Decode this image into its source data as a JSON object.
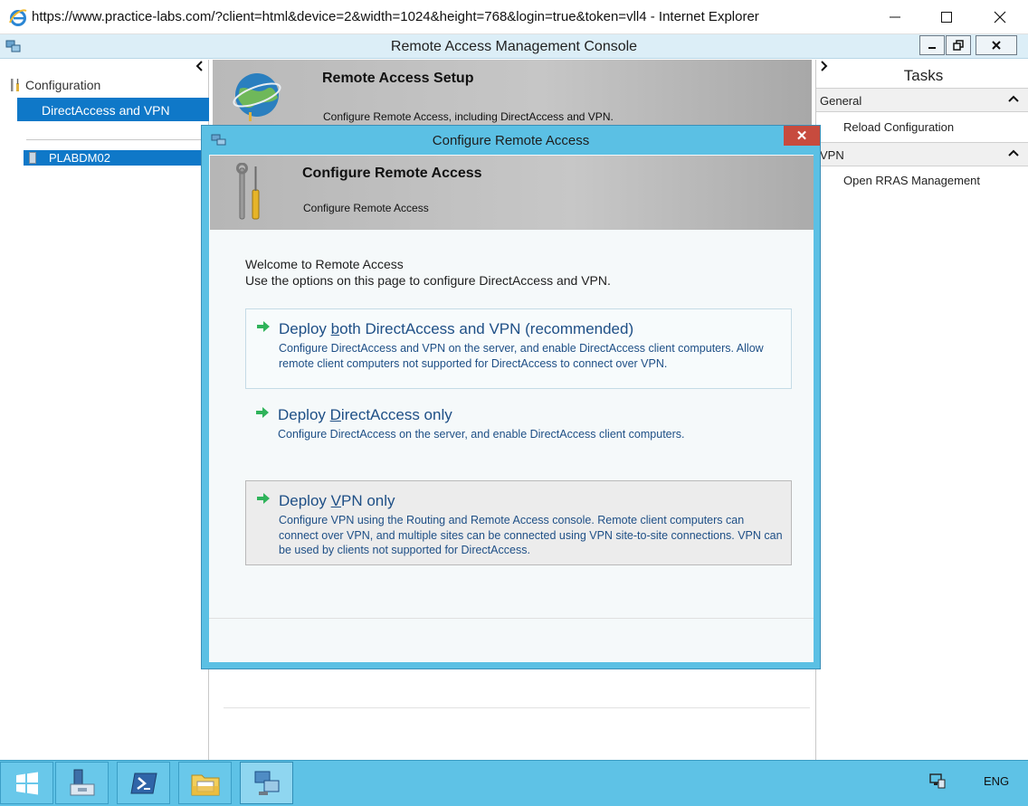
{
  "browser": {
    "title": "https://www.practice-labs.com/?client=html&device=2&width=1024&height=768&login=true&token=vll4 - Internet Explorer",
    "app_icon": "internet-explorer-icon"
  },
  "console": {
    "title": "Remote Access Management Console"
  },
  "left_nav": {
    "root_label": "Configuration",
    "selected_item": "DirectAccess and VPN",
    "server_name": "PLABDM02"
  },
  "center": {
    "banner_title": "Remote Access Setup",
    "banner_desc": "Configure Remote Access, including DirectAccess and VPN."
  },
  "tasks": {
    "title": "Tasks",
    "groups": [
      {
        "header": "General",
        "items": [
          "Reload Configuration"
        ]
      },
      {
        "header": "VPN",
        "items": [
          "Open RRAS Management"
        ]
      }
    ]
  },
  "dialog": {
    "title": "Configure Remote Access",
    "close_label": "✕",
    "banner_title": "Configure Remote Access",
    "banner_desc": "Configure Remote Access",
    "welcome_line1": "Welcome to Remote Access",
    "welcome_line2": "Use the options on this page to configure DirectAccess and VPN.",
    "options": [
      {
        "title_pre": "Deploy ",
        "title_key": "b",
        "title_post": "oth DirectAccess and VPN (recommended)",
        "desc": "Configure DirectAccess and VPN on the server, and enable DirectAccess client computers. Allow remote client computers not supported for DirectAccess to connect over VPN."
      },
      {
        "title_pre": "Deploy ",
        "title_key": "D",
        "title_post": "irectAccess only",
        "desc": "Configure DirectAccess on the server, and enable DirectAccess client computers."
      },
      {
        "title_pre": "Deploy ",
        "title_key": "V",
        "title_post": "PN only",
        "desc": "Configure VPN using the Routing and Remote Access console. Remote client computers can connect over VPN, and multiple sites can be connected using VPN site-to-site connections. VPN can be used by clients not supported for DirectAccess."
      }
    ]
  },
  "taskbar": {
    "buttons": [
      "start-icon",
      "server-manager-icon",
      "powershell-icon",
      "file-explorer-icon",
      "remote-access-console-icon"
    ],
    "language": "ENG"
  },
  "colors": {
    "accent": "#0f78c8",
    "link": "#1e4f86",
    "dialog_frame": "#5bc0e4",
    "close": "#c74b3e",
    "arrow": "#2fb35a"
  }
}
